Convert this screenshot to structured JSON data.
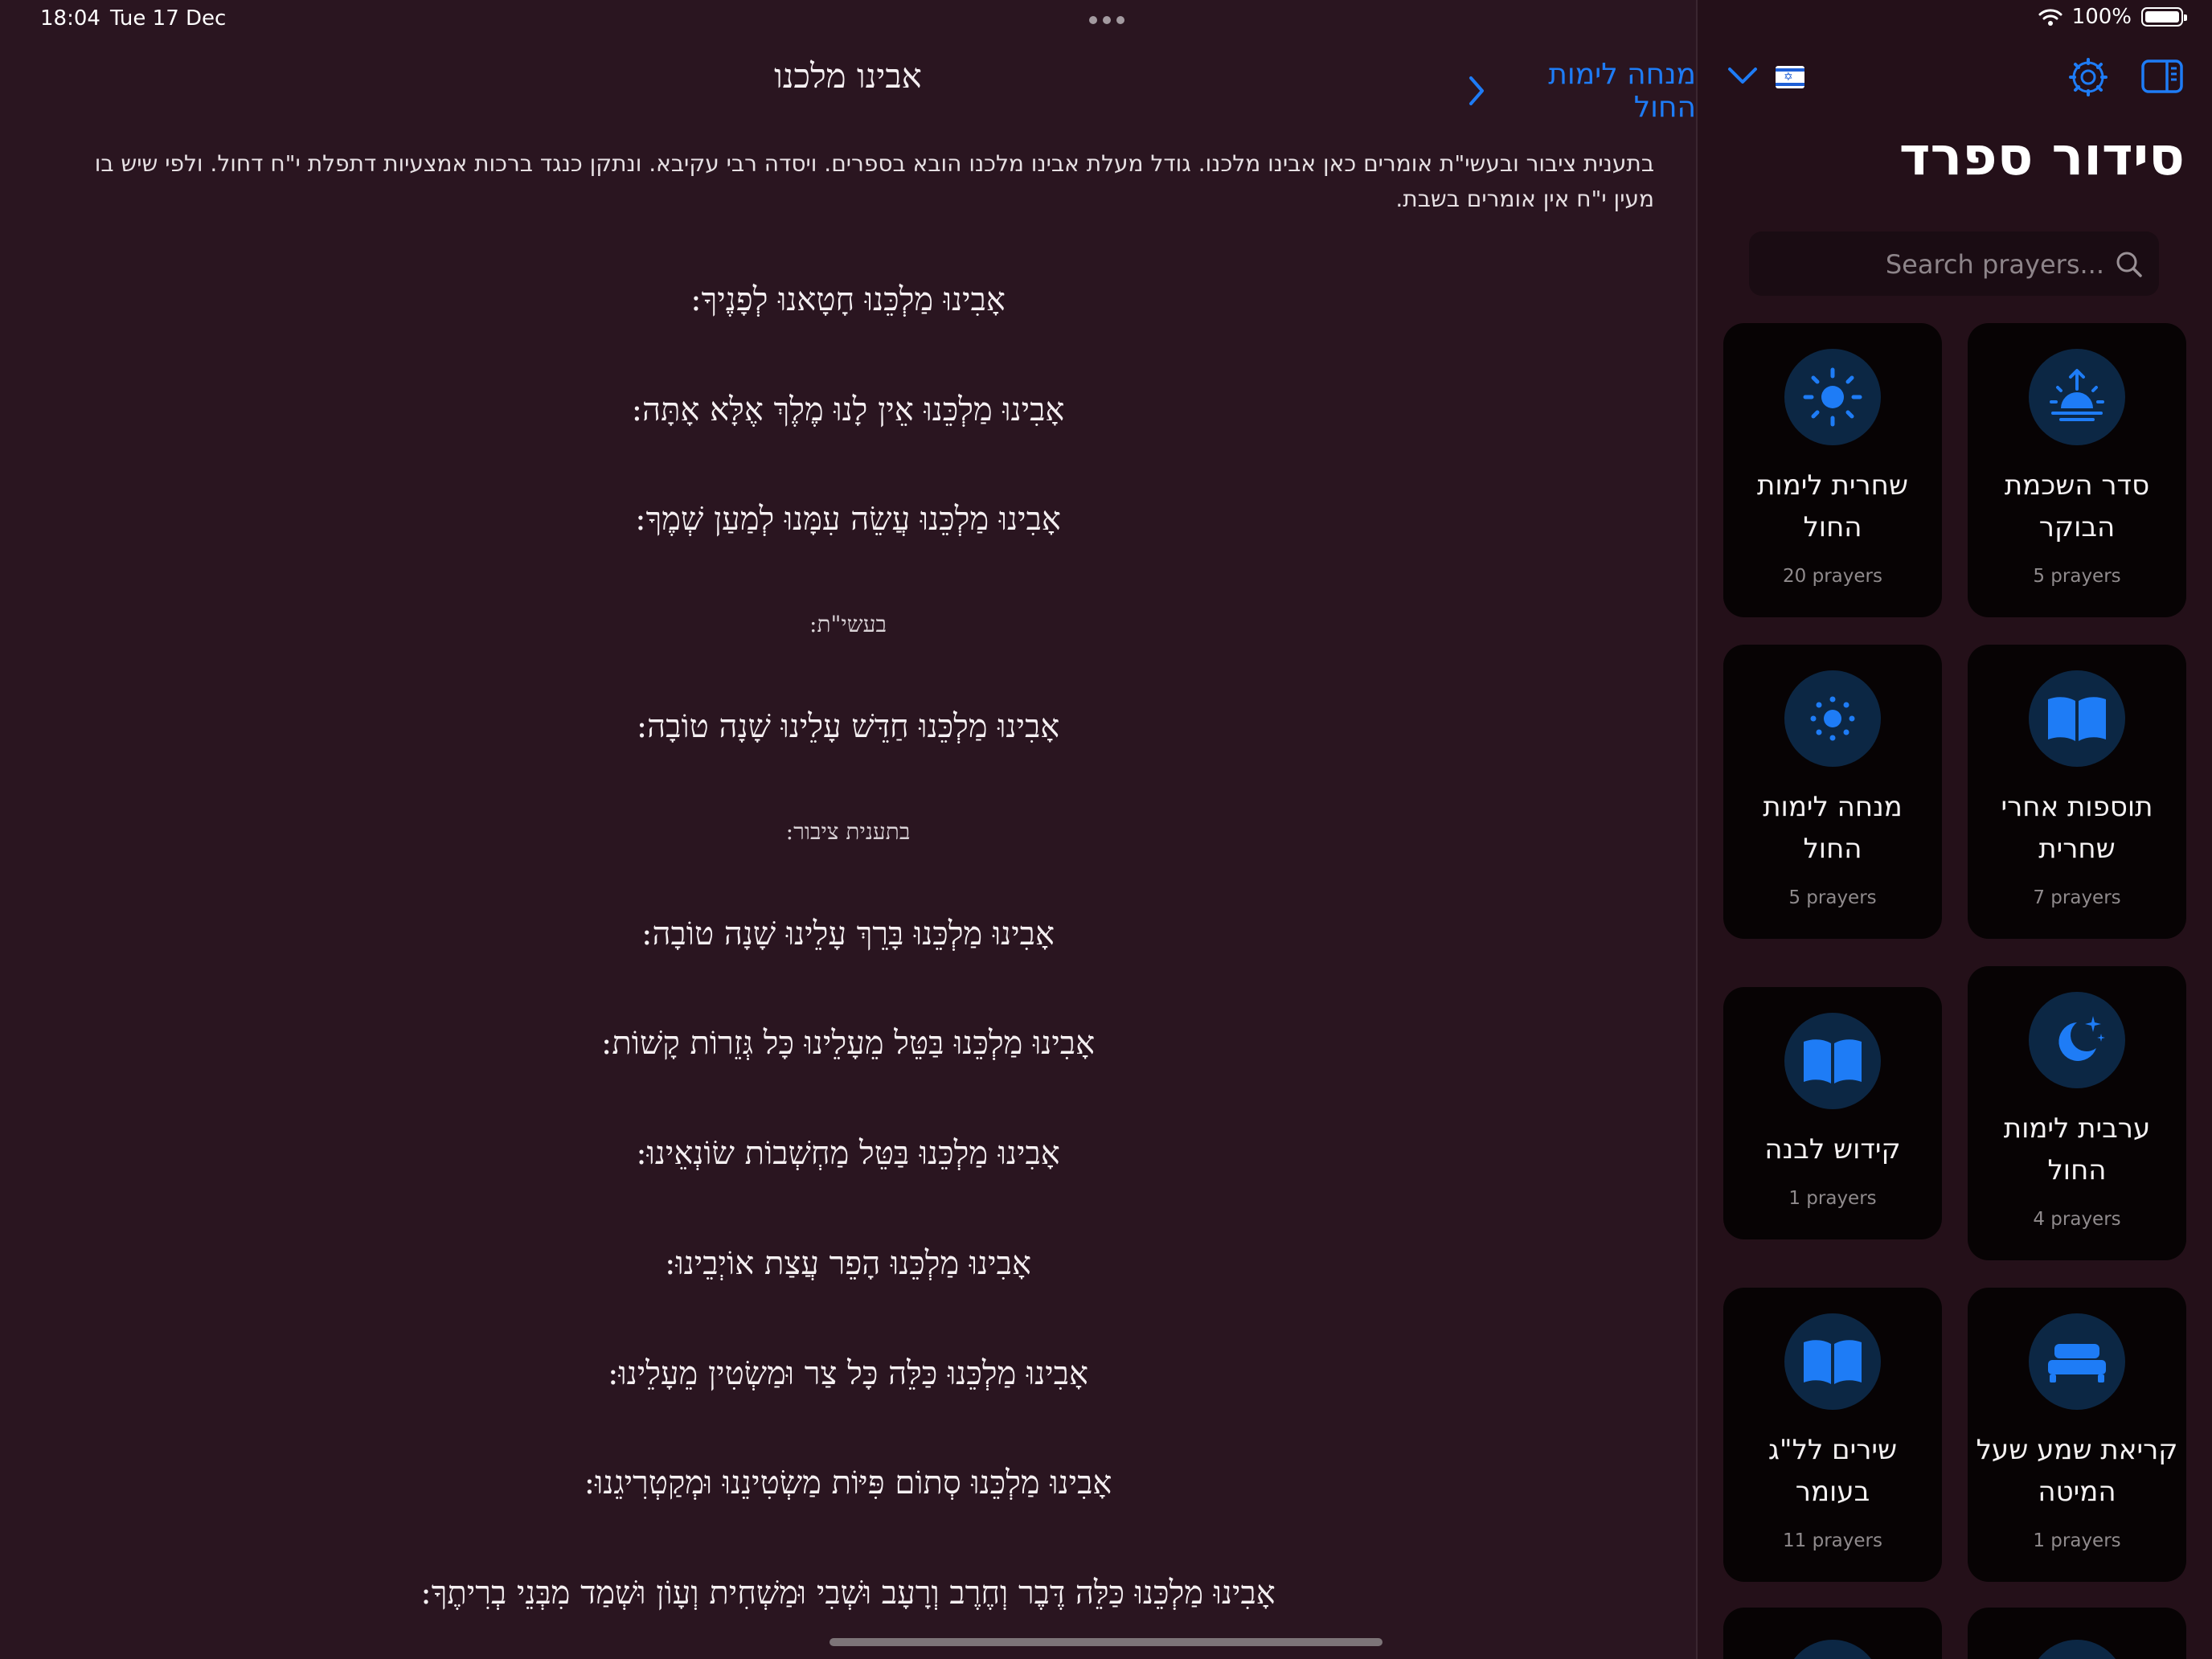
{
  "status_bar": {
    "time": "18:04",
    "date": "Tue 17 Dec",
    "battery": "100%"
  },
  "reader": {
    "title": "אבינו מלכנו",
    "back_label": "מנחה לימות החול",
    "intro": "בתענית ציבור ובעשי\"ת אומרים כאן אבינו מלכנו. גודל מעלת אבינו מלכנו הובא בספרים. ויסדה רבי עקיבא. ונתקן כנגד ברכות אמצעיות דתפלת י\"ח דחול. ולפי שיש בו מעין י\"ח אין אומרים בשבת.",
    "lines": [
      "אָבִינוּ מַלְכֵּנוּ חָטָאנוּ לְפָנֶיךָ:",
      "אָבִינוּ מַלְכֵּנוּ אֵין לָנוּ מֶלֶךְ אֶלָּא אָתָּה:",
      "אָבִינוּ מַלְכֵּנוּ עֲשֵׂה עִמָּנוּ לְמַעַן שְׁמֶךָ:",
      "בעשי\"ת:",
      "אָבִינוּ מַלְכֵּנוּ חַדֵּשׁ עָלֵינוּ שָׁנָה טוֹבָה:",
      "בתענית ציבור:",
      "אָבִינוּ מַלְכֵּנוּ בָּרֵךְ עָלֵינוּ שָׁנָה טוֹבָה:",
      "אָבִינוּ מַלְכֵּנוּ בַּטֵּל מֵעָלֵינוּ כָּל גְּזֵרוֹת קָשׁוֹת:",
      "אָבִינוּ מַלְכֵּנוּ בַּטֵּל מַחְשְׁבוֹת שׂוֹנְאֵינוּ:",
      "אָבִינוּ מַלְכֵּנוּ הָפֵר עֲצַת אוֹיְבֵינוּ:",
      "אָבִינוּ מַלְכֵּנוּ כַּלֵּה כָּל צַר וּמַשְׂטִין מֵעָלֵינוּ:",
      "אָבִינוּ מַלְכֵּנוּ סְתוֹם פִּיּוֹת מַשְׂטִינֵנוּ וּמְקַטְרִיגֵנוּ:",
      "אָבִינוּ מַלְכֵּנוּ כַּלֵּה דֶּבֶר וְחֶרֶב וְרָעָב וּשְׁבִי וּמַשְׁחִית וְעָוֹן וּשְׁמַד מִבְּנֵי בְרִיתֶךָ:"
    ]
  },
  "sidebar": {
    "title": "סידור ספרד",
    "search_placeholder": "Search prayers...",
    "cards": [
      {
        "title": "סדר השכמת הבוקר",
        "count": "5 prayers",
        "icon": "sunrise-icon"
      },
      {
        "title": "שחרית לימות החול",
        "count": "20 prayers",
        "icon": "sun-icon"
      },
      {
        "title": "תוספות אחרי שחרית",
        "count": "7 prayers",
        "icon": "book-icon"
      },
      {
        "title": "מנחה לימות החול",
        "count": "5 prayers",
        "icon": "sun-small-icon"
      },
      {
        "title": "ערבית לימות החול",
        "count": "4 prayers",
        "icon": "moon-stars-icon"
      },
      {
        "title": "קידוש לבנה",
        "count": "1 prayers",
        "icon": "book-icon"
      },
      {
        "title": "קריאת שמע שעל המיטה",
        "count": "1 prayers",
        "icon": "bed-icon"
      },
      {
        "title": "שירים לל\"ג בעומר",
        "count": "11 prayers",
        "icon": "book-icon"
      }
    ]
  },
  "colors": {
    "background": "#2a1520",
    "sidebar": "#241019",
    "accent": "#1e7cf6",
    "card": "#070304",
    "icon_circle": "#0c2744"
  }
}
